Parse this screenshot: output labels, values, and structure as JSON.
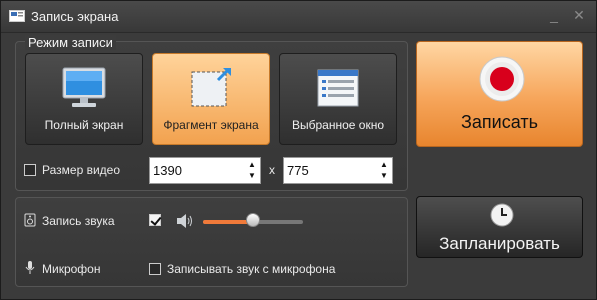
{
  "window": {
    "title": "Запись экрана",
    "minimize_glyph": "_",
    "close_glyph": "✕"
  },
  "mode": {
    "group_label": "Режим записи",
    "options": [
      {
        "label": "Полный экран",
        "icon": "monitor-icon",
        "selected": false
      },
      {
        "label": "Фрагмент экрана",
        "icon": "screen-fragment-icon",
        "selected": true
      },
      {
        "label": "Выбранное окно",
        "icon": "window-icon",
        "selected": false
      }
    ]
  },
  "video_size": {
    "label": "Размер видео",
    "width": "1390",
    "separator": "x",
    "height": "775",
    "linked_checkbox_checked": false
  },
  "audio": {
    "record_sound_label": "Запись звука",
    "record_sound_checked": true,
    "volume_level": 0.5,
    "microphone_label": "Микрофон",
    "record_mic_label": "Записывать звук с микрофона",
    "record_mic_checked": false
  },
  "actions": {
    "record_label": "Записать",
    "schedule_label": "Запланировать"
  },
  "colors": {
    "accent_orange": "#f6a55a",
    "record_red": "#d8001c",
    "slider_fill": "#f07a3a"
  }
}
